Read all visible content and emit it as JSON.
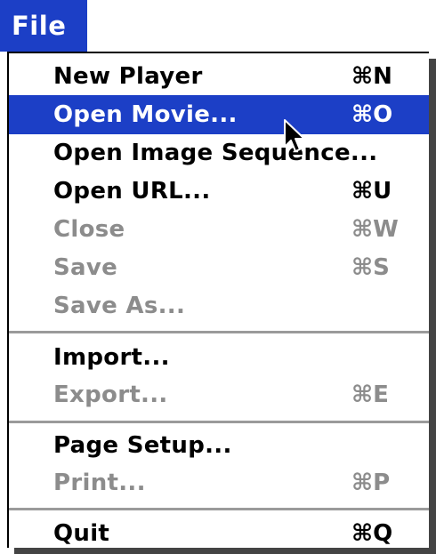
{
  "menu_title": "File",
  "items": [
    {
      "label": "New Player",
      "shortcut": "⌘N",
      "enabled": true,
      "highlighted": false
    },
    {
      "label": "Open Movie...",
      "shortcut": "⌘O",
      "enabled": true,
      "highlighted": true
    },
    {
      "label": "Open Image Sequence...",
      "shortcut": "",
      "enabled": true,
      "highlighted": false
    },
    {
      "label": "Open URL...",
      "shortcut": "⌘U",
      "enabled": true,
      "highlighted": false
    },
    {
      "label": "Close",
      "shortcut": "⌘W",
      "enabled": false,
      "highlighted": false
    },
    {
      "label": "Save",
      "shortcut": "⌘S",
      "enabled": false,
      "highlighted": false
    },
    {
      "label": "Save As...",
      "shortcut": "",
      "enabled": false,
      "highlighted": false
    },
    {
      "label": "Import...",
      "shortcut": "",
      "enabled": true,
      "highlighted": false
    },
    {
      "label": "Export...",
      "shortcut": "⌘E",
      "enabled": false,
      "highlighted": false
    },
    {
      "label": "Page Setup...",
      "shortcut": "",
      "enabled": true,
      "highlighted": false
    },
    {
      "label": "Print...",
      "shortcut": "⌘P",
      "enabled": false,
      "highlighted": false
    },
    {
      "label": "Quit",
      "shortcut": "⌘Q",
      "enabled": true,
      "highlighted": false
    }
  ],
  "icons": {
    "cursor": "arrow-pointer-icon"
  },
  "colors": {
    "highlight": "#1c3fc6",
    "disabled_text": "#8c8c8c",
    "separator": "#9a9a9a"
  }
}
